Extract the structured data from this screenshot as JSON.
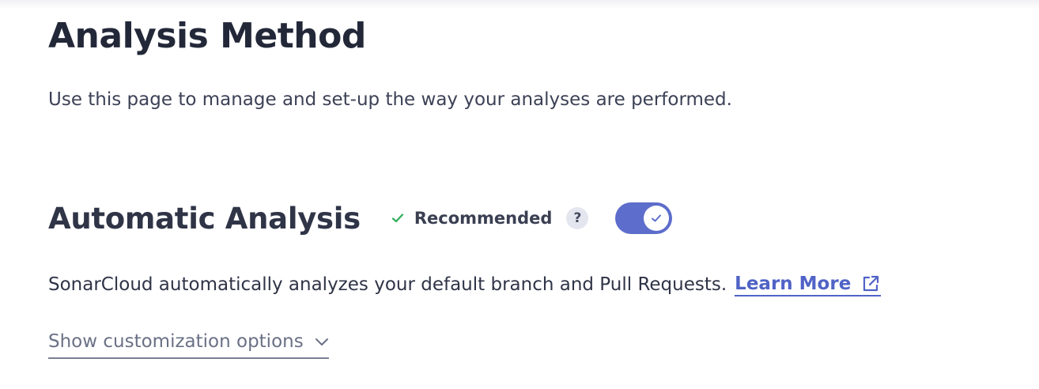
{
  "page": {
    "title": "Analysis Method",
    "description": "Use this page to manage and set-up the way your analyses are performed."
  },
  "automatic_analysis": {
    "title": "Automatic Analysis",
    "badge_label": "Recommended",
    "help_icon_text": "?",
    "toggle_state": "on",
    "description": "SonarCloud automatically analyzes your default branch and Pull Requests.",
    "learn_more_label": "Learn More",
    "customize_label": "Show customization options"
  },
  "icons": {
    "check": "check-icon",
    "help": "question-mark-icon",
    "toggle_knob": "check-icon",
    "external": "external-link-icon",
    "chevron": "chevron-down-icon"
  },
  "colors": {
    "accent": "#5d6dcb",
    "link": "#5063c6",
    "success": "#2faf5b",
    "muted_text": "#6a7186"
  }
}
